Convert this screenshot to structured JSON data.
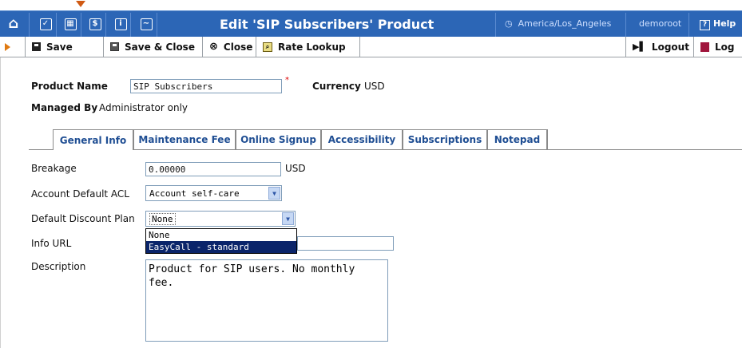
{
  "header": {
    "title": "Edit 'SIP Subscribers' Product",
    "timezone": "America/Los_Angeles",
    "user": "demoroot",
    "help": "Help",
    "icons": [
      "home-icon",
      "checkbox-icon",
      "grid-icon",
      "dollar-icon",
      "info-icon",
      "chart-icon"
    ],
    "icon_glyphs": {
      "home": "⌂",
      "check": "✓",
      "grid": "▦",
      "dollar": "$",
      "info": "i",
      "chart": "∼"
    }
  },
  "toolbar": {
    "save": "Save",
    "save_close": "Save & Close",
    "close": "Close",
    "rate_lookup": "Rate Lookup",
    "logout": "Logout",
    "log": "Log"
  },
  "form": {
    "product_name_label": "Product Name",
    "product_name_value": "SIP Subscribers",
    "required_mark": "*",
    "currency_label": "Currency",
    "currency_value": "USD",
    "managed_by_label": "Managed By",
    "managed_by_value": "Administrator only"
  },
  "tabs": [
    "General Info",
    "Maintenance Fee",
    "Online Signup",
    "Accessibility",
    "Subscriptions",
    "Notepad"
  ],
  "general": {
    "breakage_label": "Breakage",
    "breakage_value": "0.00000",
    "breakage_unit": "USD",
    "acl_label": "Account Default ACL",
    "acl_value": "Account self-care",
    "discount_label": "Default Discount Plan",
    "discount_value": "None",
    "discount_options": [
      "None",
      "EasyCall - standard"
    ],
    "info_url_label": "Info URL",
    "info_url_value": "",
    "description_label": "Description",
    "description_value": "Product for SIP users. No monthly\nfee."
  },
  "colors": {
    "header_bg": "#2c66b6",
    "tab_text": "#1f4e93",
    "highlight": "#0a246a"
  }
}
